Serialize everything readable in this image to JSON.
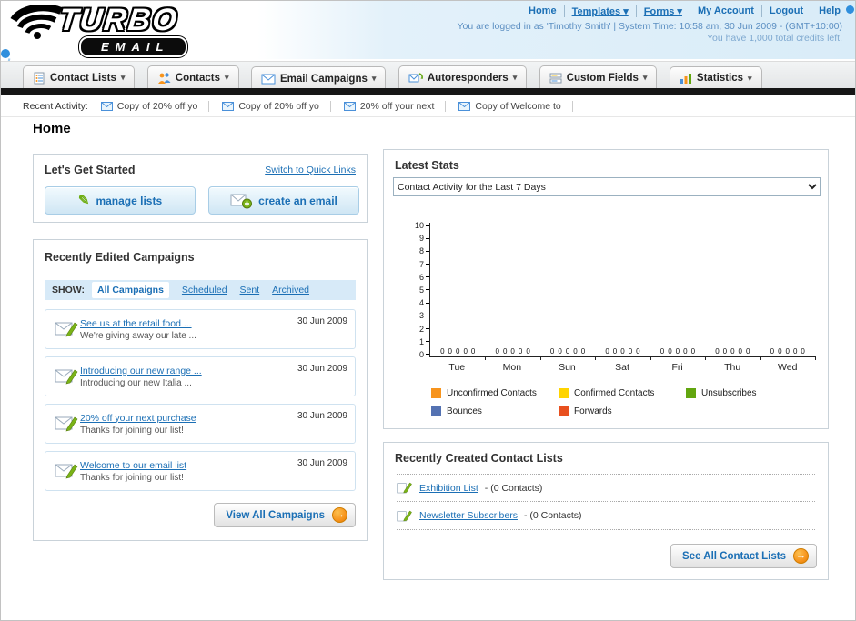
{
  "header": {
    "logo_top": "TURBO",
    "logo_bottom": "EMAIL",
    "links": [
      "Home",
      "Templates ▾",
      "Forms ▾",
      "My Account",
      "Logout",
      "Help"
    ],
    "login_status": "You are logged in as 'Timothy Smith' | System Time: 10:58 am, 30 Jun 2009 - (GMT+10:00)",
    "credits": "You have 1,000 total credits left."
  },
  "nav_tabs": [
    {
      "label": "Contact Lists"
    },
    {
      "label": "Contacts"
    },
    {
      "label": "Email Campaigns"
    },
    {
      "label": "Autoresponders"
    },
    {
      "label": "Custom Fields"
    },
    {
      "label": "Statistics"
    }
  ],
  "recent_activity": {
    "label": "Recent Activity:",
    "items": [
      "Copy of 20% off yo",
      "Copy of 20% off yo",
      "20% off your next",
      "Copy of Welcome to"
    ]
  },
  "page": {
    "title": "Home"
  },
  "get_started": {
    "title": "Let's Get Started",
    "switch_link": "Switch to Quick Links",
    "manage_lists_button": "manage lists",
    "create_email_button": "create an email"
  },
  "campaigns": {
    "title": "Recently Edited Campaigns",
    "show_label": "SHOW:",
    "filters": [
      "All Campaigns",
      "Scheduled",
      "Sent",
      "Archived"
    ],
    "items": [
      {
        "title": "See us at the retail food ...",
        "subtitle": "We're giving away our late ...",
        "date": "30 Jun 2009"
      },
      {
        "title": "Introducing our new range ...",
        "subtitle": "Introducing our new Italia ...",
        "date": "30 Jun 2009"
      },
      {
        "title": "20% off your next purchase",
        "subtitle": "Thanks for joining our list!",
        "date": "30 Jun 2009"
      },
      {
        "title": "Welcome to our email list",
        "subtitle": "Thanks for joining our list!",
        "date": "30 Jun 2009"
      }
    ],
    "view_all_button": "View All Campaigns"
  },
  "stats": {
    "title": "Latest Stats",
    "dropdown_value": "Contact Activity for the Last 7 Days",
    "chart_data": {
      "type": "bar",
      "categories": [
        "Tue",
        "Mon",
        "Sun",
        "Sat",
        "Fri",
        "Thu",
        "Wed"
      ],
      "series": [
        {
          "name": "Unconfirmed Contacts",
          "color": "#f7941d",
          "values": [
            0,
            0,
            0,
            0,
            0,
            0,
            0
          ]
        },
        {
          "name": "Confirmed Contacts",
          "color": "#ffd400",
          "values": [
            0,
            0,
            0,
            0,
            0,
            0,
            0
          ]
        },
        {
          "name": "Unsubscribes",
          "color": "#62a60f",
          "values": [
            0,
            0,
            0,
            0,
            0,
            0,
            0
          ]
        },
        {
          "name": "Bounces",
          "color": "#5472b2",
          "values": [
            0,
            0,
            0,
            0,
            0,
            0,
            0
          ]
        },
        {
          "name": "Forwards",
          "color": "#e8501f",
          "values": [
            0,
            0,
            0,
            0,
            0,
            0,
            0
          ]
        }
      ],
      "ylim": [
        0,
        10
      ],
      "grid": false,
      "legend_position": "bottom"
    }
  },
  "contact_lists": {
    "title": "Recently Created Contact Lists",
    "items": [
      {
        "name": "Exhibition List",
        "detail": "- (0 Contacts)"
      },
      {
        "name": "Newsletter Subscribers",
        "detail": "- (0 Contacts)"
      }
    ],
    "see_all_button": "See All Contact Lists"
  },
  "icons": {
    "dropdown_arrow": "▾",
    "button_arrow": "→",
    "pencil": "✎"
  }
}
